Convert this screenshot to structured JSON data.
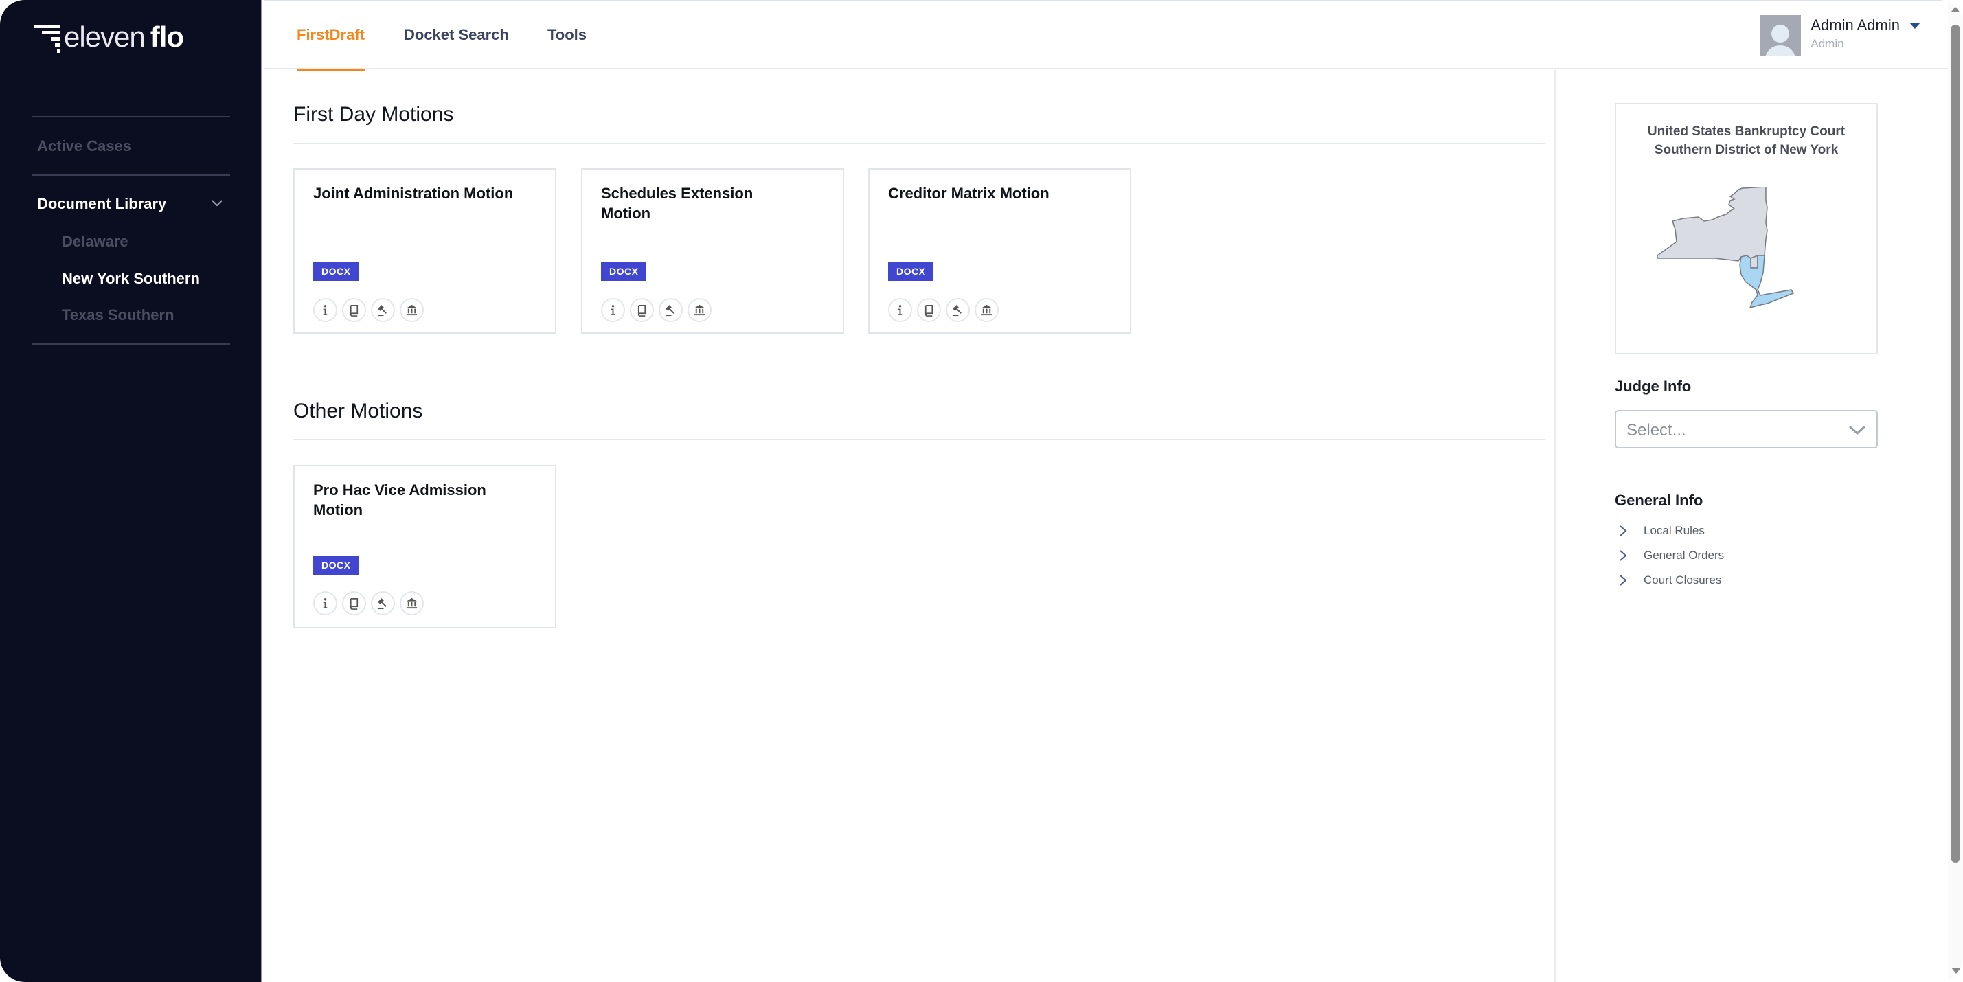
{
  "app": {
    "logo_light": "eleven",
    "logo_bold": "flo"
  },
  "sidebar": {
    "items": [
      {
        "label": "Active Cases",
        "state": "muted"
      },
      {
        "label": "Document Library",
        "state": "expanded"
      }
    ],
    "sub_items": [
      {
        "label": "Delaware",
        "state": "muted"
      },
      {
        "label": "New York Southern",
        "state": "active"
      },
      {
        "label": "Texas Southern",
        "state": "muted"
      }
    ]
  },
  "nav": {
    "tabs": [
      {
        "label": "FirstDraft",
        "active": true
      },
      {
        "label": "Docket Search",
        "active": false
      },
      {
        "label": "Tools",
        "active": false
      }
    ]
  },
  "user": {
    "name": "Admin Admin",
    "role": "Admin"
  },
  "sections": [
    {
      "title": "First Day Motions",
      "cards": [
        {
          "title": "Joint Administration Motion",
          "badge": "DOCX"
        },
        {
          "title": "Schedules Extension Motion",
          "badge": "DOCX"
        },
        {
          "title": "Creditor Matrix Motion",
          "badge": "DOCX"
        }
      ]
    },
    {
      "title": "Other Motions",
      "cards": [
        {
          "title": "Pro Hac Vice Admission Motion",
          "badge": "DOCX"
        }
      ]
    }
  ],
  "card_icons": [
    "info-icon",
    "book-icon",
    "gavel-icon",
    "courthouse-icon"
  ],
  "right_panel": {
    "court_line1": "United States Bankruptcy Court",
    "court_line2": "Southern District of New York",
    "judge_label": "Judge Info",
    "judge_select_placeholder": "Select...",
    "general_label": "General Info",
    "general_items": [
      "Local Rules",
      "General Orders",
      "Court Closures"
    ]
  },
  "colors": {
    "sidebar_bg": "#0b0d20",
    "accent_orange": "#f7851a",
    "badge_blue": "#4046cf",
    "map_state": "#d9dce3",
    "map_district": "#a9d6f2"
  }
}
